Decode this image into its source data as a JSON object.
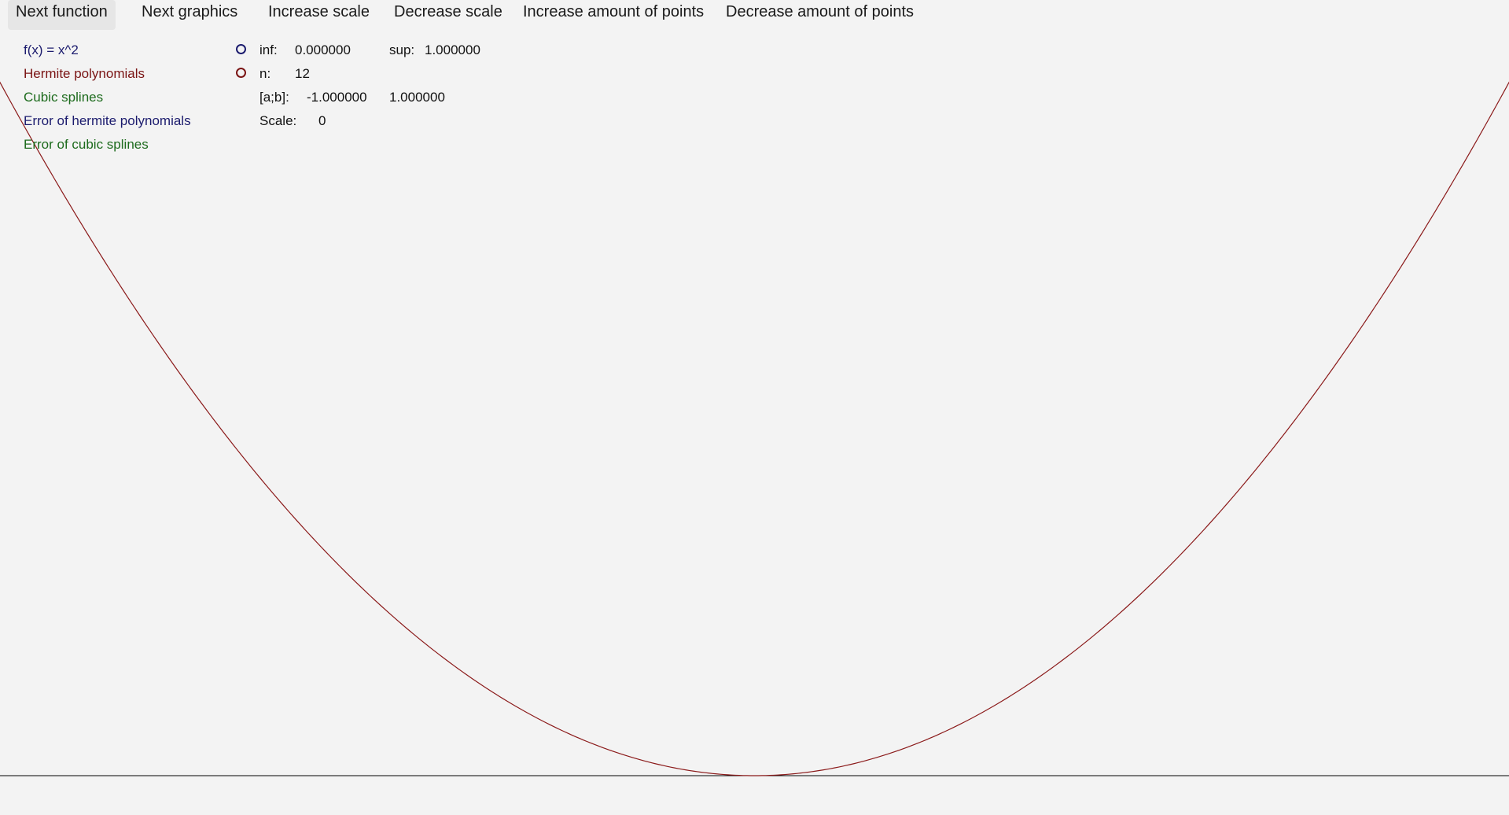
{
  "toolbar": {
    "next_function": "Next function",
    "next_graphics": "Next graphics",
    "increase_scale": "Increase scale",
    "decrease_scale": "Decrease scale",
    "increase_points": "Increase amount of points",
    "decrease_points": "Decrease amount of points"
  },
  "legend": {
    "function": {
      "label": "f(x) = x^2",
      "color": "#1c1c6e"
    },
    "hermite": {
      "label": "Hermite polynomials",
      "color": "#7a1414"
    },
    "splines": {
      "label": "Cubic splines",
      "color": "#1d6b1d"
    },
    "hermite_error": {
      "label": "Error of hermite polynomials",
      "color": "#1c1c6e"
    },
    "spline_error": {
      "label": "Error of cubic splines",
      "color": "#1d6b1d"
    }
  },
  "radios": {
    "function_color": "#1c1c6e",
    "hermite_color": "#7a1414"
  },
  "info": {
    "inf_label": "inf:",
    "inf_value": "0.000000",
    "sup_label": "sup:",
    "sup_value": "1.000000",
    "n_label": "n:",
    "n_value": "12",
    "interval_label": "[a;b]:",
    "a_value": "-1.000000",
    "b_value": "1.000000",
    "scale_label": "Scale:",
    "scale_value": "0"
  },
  "chart_data": {
    "type": "line",
    "function": "x^2",
    "xlim": [
      -1.0,
      1.0
    ],
    "ylim": [
      0.0,
      1.0
    ],
    "series": [
      {
        "name": "Hermite polynomials",
        "color": "#8b1a1a",
        "x": [
          -1.0,
          -0.8,
          -0.6,
          -0.4,
          -0.2,
          0.0,
          0.2,
          0.4,
          0.6,
          0.8,
          1.0
        ],
        "y": [
          1.0,
          0.64,
          0.36,
          0.16,
          0.04,
          0.0,
          0.04,
          0.16,
          0.36,
          0.64,
          1.0
        ]
      }
    ],
    "axis_color": "#000000"
  }
}
